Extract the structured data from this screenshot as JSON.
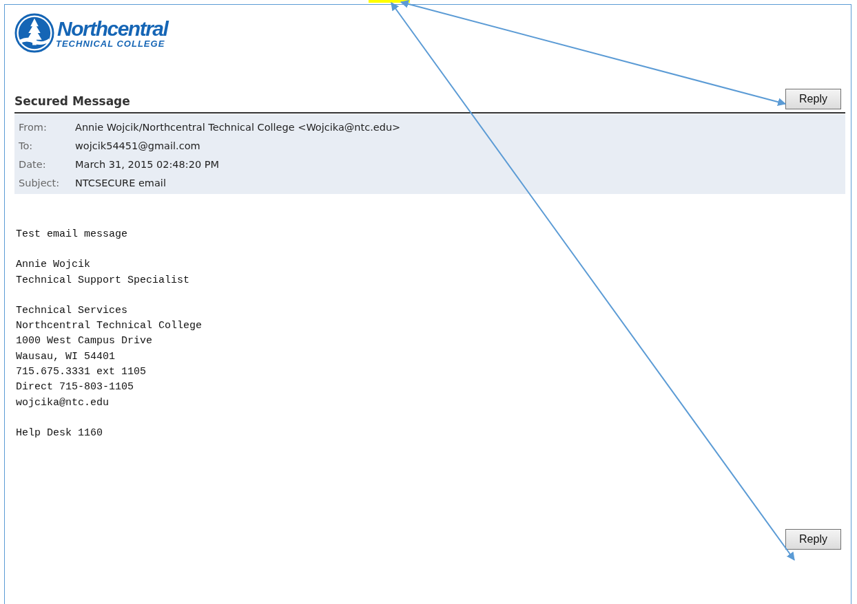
{
  "logo": {
    "name": "Northcentral",
    "subtitle": "TECHNICAL COLLEGE"
  },
  "heading": "Secured Message",
  "reply_buttons": [
    "Reply",
    "Reply"
  ],
  "headers": [
    {
      "label": "From:",
      "value": "Annie Wojcik/Northcentral Technical College <Wojcika@ntc.edu>"
    },
    {
      "label": "To:",
      "value": "wojcik54451@gmail.com"
    },
    {
      "label": "Date:",
      "value": "March 31, 2015 02:48:20 PM"
    },
    {
      "label": "Subject:",
      "value": "NTCSECURE email"
    }
  ],
  "body": [
    [
      "Test email message"
    ],
    [
      "Annie Wojcik",
      "Technical Support Specialist"
    ],
    [
      "Technical Services",
      "Northcentral Technical College",
      "1000 West Campus Drive",
      "Wausau, WI 54401",
      "715.675.3331 ext 1105",
      "Direct 715-803-1105",
      "wojcika@ntc.edu"
    ],
    [
      "Help Desk 1160"
    ]
  ]
}
